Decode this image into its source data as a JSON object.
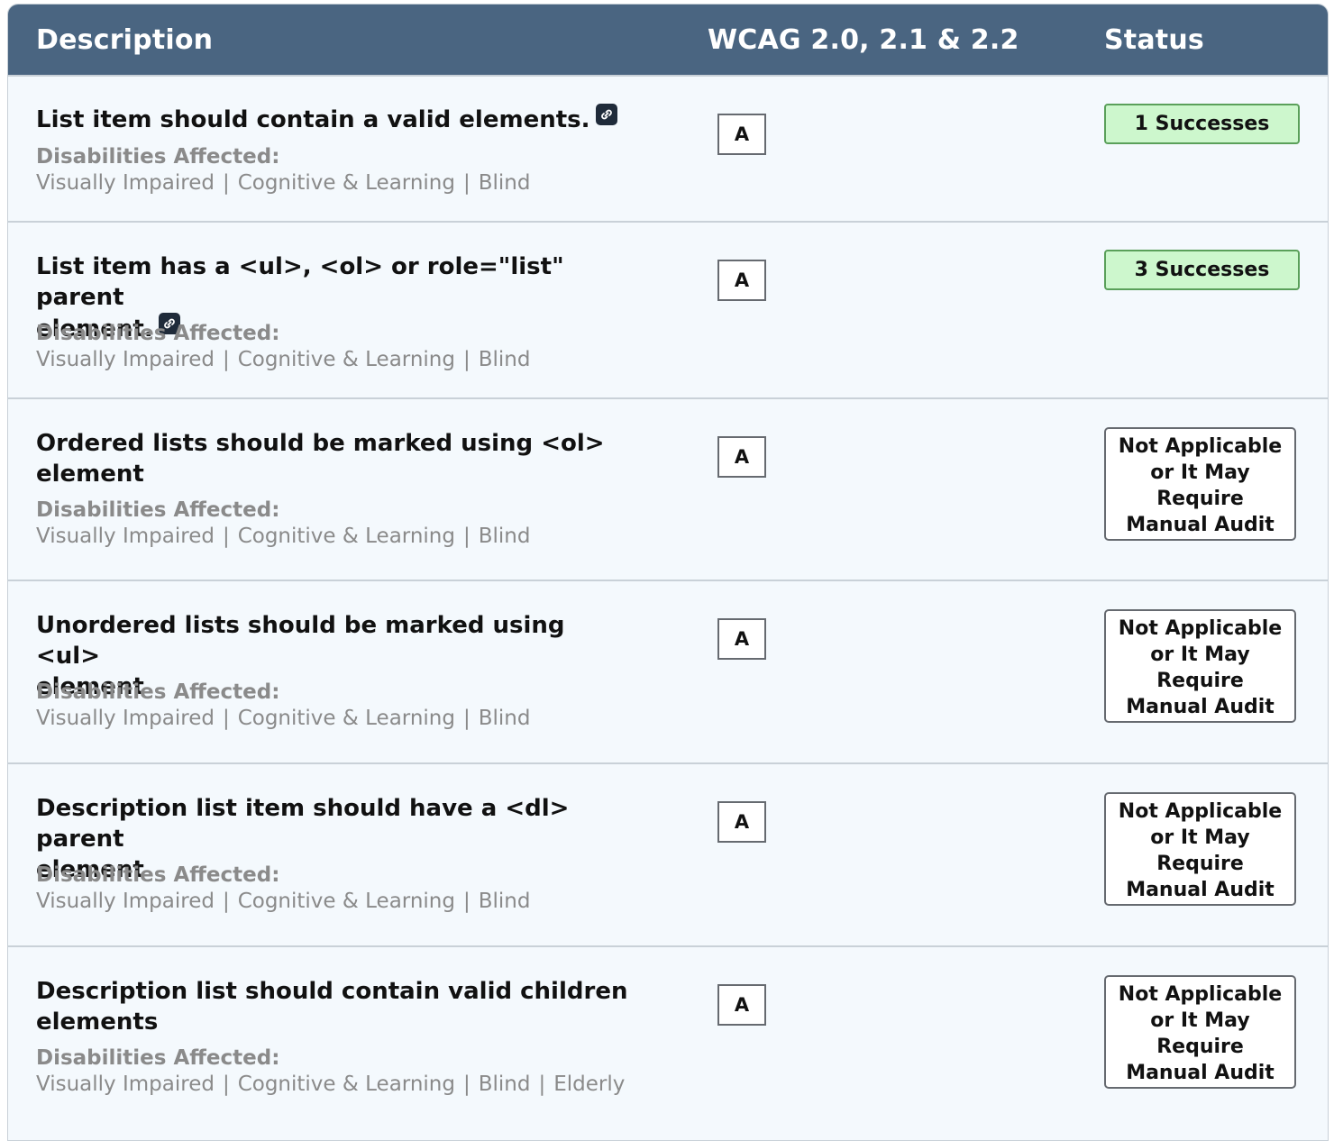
{
  "header": {
    "description": "Description",
    "wcag": "WCAG 2.0, 2.1 & 2.2",
    "status": "Status"
  },
  "disabilities_label": "Disabilities Affected:",
  "rows": [
    {
      "title": "List item should contain a valid elements.",
      "has_link_icon": true,
      "disabilities": [
        "Visually Impaired",
        "Cognitive & Learning",
        "Blind"
      ],
      "level": "A",
      "status": "1 Successes",
      "status_type": "success"
    },
    {
      "title_line1": "List item has a <ul>, <ol> or role=\"list\" parent",
      "title_line2": "element.",
      "has_link_icon": true,
      "disabilities": [
        "Visually Impaired",
        "Cognitive & Learning",
        "Blind"
      ],
      "level": "A",
      "status": "3 Successes",
      "status_type": "success"
    },
    {
      "title_line1": "Ordered lists should be marked using <ol>",
      "title_line2": "element",
      "disabilities": [
        "Visually Impaired",
        "Cognitive & Learning",
        "Blind"
      ],
      "level": "A",
      "status_lines": [
        "Not Applicable",
        "or It May",
        "Require",
        "Manual Audit"
      ],
      "status_type": "na"
    },
    {
      "title_line1": "Unordered lists should be marked using <ul>",
      "title_line2": "element",
      "disabilities": [
        "Visually Impaired",
        "Cognitive & Learning",
        "Blind"
      ],
      "level": "A",
      "status_lines": [
        "Not Applicable",
        "or It May",
        "Require",
        "Manual Audit"
      ],
      "status_type": "na"
    },
    {
      "title_line1": "Description list item should have a <dl> parent",
      "title_line2": "element",
      "disabilities": [
        "Visually Impaired",
        "Cognitive & Learning",
        "Blind"
      ],
      "level": "A",
      "status_lines": [
        "Not Applicable",
        "or It May",
        "Require",
        "Manual Audit"
      ],
      "status_type": "na"
    },
    {
      "title_line1": "Description list should contain valid children",
      "title_line2": "elements",
      "disabilities": [
        "Visually Impaired",
        "Cognitive & Learning",
        "Blind",
        "Elderly"
      ],
      "level": "A",
      "status_lines": [
        "Not Applicable",
        "or It May",
        "Require",
        "Manual Audit"
      ],
      "status_type": "na"
    }
  ]
}
